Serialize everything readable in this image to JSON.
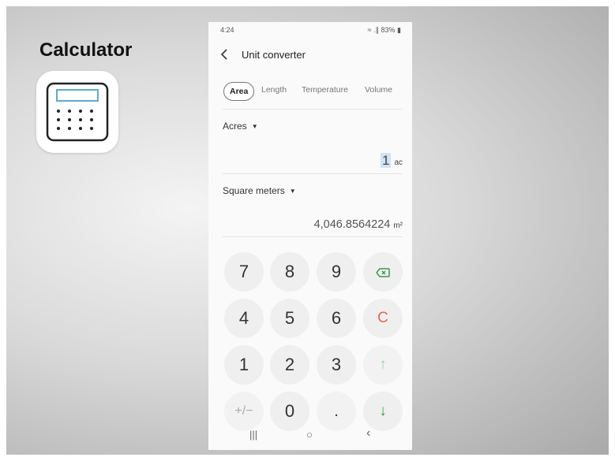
{
  "slide": {
    "title": "Calculator",
    "icon": "calculator-icon"
  },
  "phone": {
    "status": {
      "time": "4:24",
      "indicators": "≈ .∥ 83% ▮"
    },
    "header": {
      "back_icon": "back-arrow-icon",
      "title": "Unit converter"
    },
    "tabs": [
      {
        "label": "Area",
        "active": true
      },
      {
        "label": "Length",
        "active": false
      },
      {
        "label": "Temperature",
        "active": false
      },
      {
        "label": "Volume",
        "active": false
      }
    ],
    "from": {
      "unit": "Acres",
      "value": "1",
      "unit_abbr": "ac"
    },
    "to": {
      "unit": "Square meters",
      "value": "4,046.8564224",
      "unit_abbr": "m²"
    },
    "caret": "▼",
    "keypad": {
      "k7": "7",
      "k8": "8",
      "k9": "9",
      "backspace": "⌫",
      "k4": "4",
      "k5": "5",
      "k6": "6",
      "clear": "C",
      "k1": "1",
      "k2": "2",
      "k3": "3",
      "up": "↑",
      "sign": "+/−",
      "k0": "0",
      "dot": ".",
      "down": "↓"
    },
    "navbar": {
      "recents": "|||",
      "home": "○",
      "back": "‹"
    },
    "colors": {
      "green": "#35a048",
      "light_green": "#9fd3a4",
      "clear_red": "#e06a55",
      "selection": "#cfe3f3"
    }
  }
}
